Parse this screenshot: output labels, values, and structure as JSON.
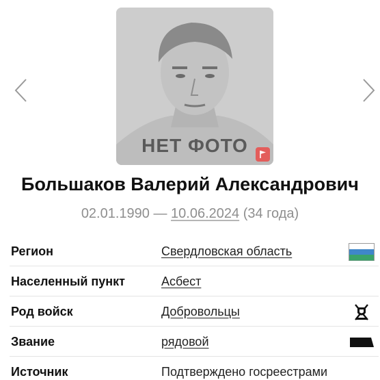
{
  "navigation": {
    "prev_icon": "chevron-left-icon",
    "next_icon": "chevron-right-icon"
  },
  "photo": {
    "placeholder_label": "НЕТ ФОТО",
    "flag_icon": "flag-icon",
    "flag_color": "#e35d5b"
  },
  "person": {
    "name": "Большаков Валерий Александрович",
    "birth_date": "02.01.1990",
    "separator": "—",
    "death_date": "10.06.2024",
    "age": "(34 года)"
  },
  "details": [
    {
      "label": "Регион",
      "value": "Свердловская область",
      "icon": "sverdlovsk-region-flag-icon"
    },
    {
      "label": "Населенный пункт",
      "value": "Асбест",
      "icon": ""
    },
    {
      "label": "Род войск",
      "value": "Добровольцы",
      "icon": "volunteers-emblem-icon"
    },
    {
      "label": "Звание",
      "value": "рядовой",
      "icon": "private-rank-insignia-icon"
    },
    {
      "label": "Источник",
      "value": "Подтверждено госреестрами",
      "icon": ""
    }
  ]
}
